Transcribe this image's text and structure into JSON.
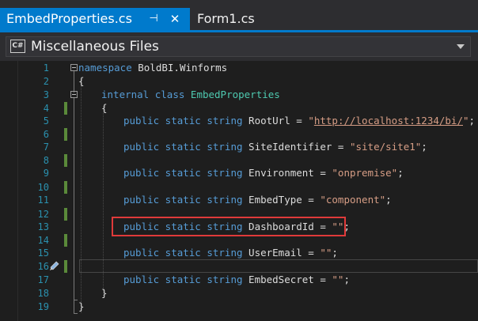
{
  "tabs": {
    "active": {
      "label": "EmbedProperties.cs",
      "pin_glyph": "⊣",
      "close_glyph": "✕"
    },
    "inactive": {
      "label": "Form1.cs"
    }
  },
  "navbar": {
    "badge": "C#",
    "label": "Miscellaneous Files"
  },
  "colors": {
    "accent": "#007acc",
    "keyword": "#569cd6",
    "type": "#4ec9b0",
    "string": "#d69d85",
    "line_number": "#2b91af",
    "highlight_border": "#e03a3a"
  },
  "editor": {
    "line_numbers": [
      "1",
      "2",
      "3",
      "4",
      "5",
      "6",
      "7",
      "8",
      "9",
      "10",
      "11",
      "12",
      "13",
      "14",
      "15",
      "16",
      "17",
      "18",
      "19"
    ],
    "line1": {
      "kw": "namespace",
      "rest": " BoldBI.Winforms"
    },
    "line2": {
      "text": "{"
    },
    "line3": {
      "kw1": "internal",
      "kw2": "class",
      "type": "EmbedProperties"
    },
    "line4": {
      "text": "{"
    },
    "line5": {
      "kw": "public static string",
      "name": " RootUrl = ",
      "q1": "\"",
      "url": "http://localhost:1234/bi/",
      "q2": "\"",
      "end": ";"
    },
    "line7": {
      "kw": "public static string",
      "name": " SiteIdentifier = ",
      "str": "\"site/site1\"",
      "end": ";"
    },
    "line9": {
      "kw": "public static string",
      "name": " Environment = ",
      "str": "\"onpremise\"",
      "end": ";"
    },
    "line11": {
      "kw": "public static string",
      "name": " EmbedType = ",
      "str": "\"component\"",
      "end": ";"
    },
    "line13": {
      "kw": "public static string",
      "name": " DashboardId = ",
      "str": "\"\"",
      "end": ";"
    },
    "line15": {
      "kw": "public static string",
      "name": " UserEmail = ",
      "str": "\"\"",
      "end": ";"
    },
    "line17": {
      "kw": "public static string",
      "name": " EmbedSecret = ",
      "str": "\"\"",
      "end": ";"
    },
    "line18": {
      "text": "}"
    },
    "line19": {
      "text": "}"
    }
  }
}
